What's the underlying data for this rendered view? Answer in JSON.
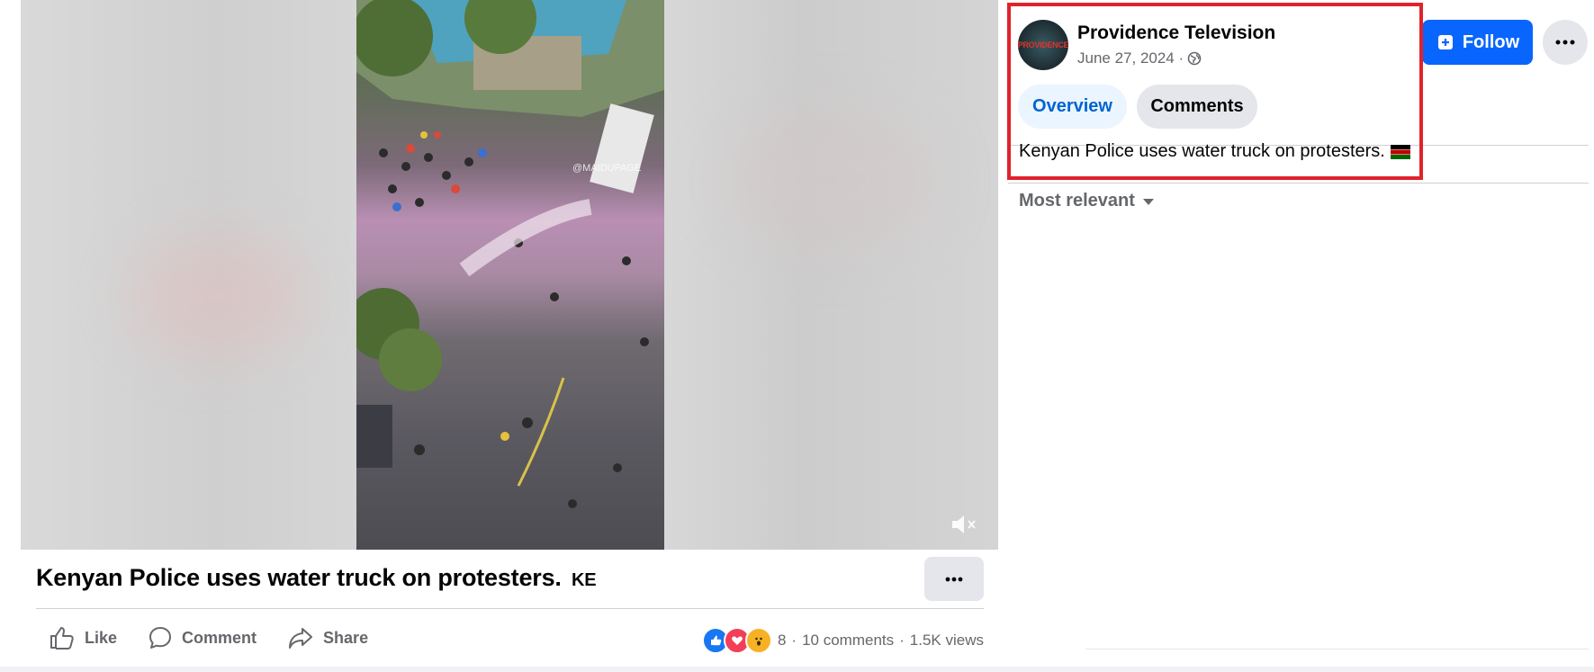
{
  "video": {
    "watermark": "@MAIDUPAGE"
  },
  "post": {
    "title": "Kenyan Police uses water truck on protesters.",
    "title_flag_code": "KE"
  },
  "actions": {
    "like": "Like",
    "comment": "Comment",
    "share": "Share"
  },
  "stats": {
    "reactions_count": "8",
    "separator": "·",
    "comments": "10 comments",
    "views": "1.5K views"
  },
  "page": {
    "name": "Providence Television",
    "date": "June 27, 2024 ·",
    "follow_label": "Follow"
  },
  "tabs": [
    {
      "label": "Overview",
      "active": true
    },
    {
      "label": "Comments",
      "active": false
    }
  ],
  "caption": "Kenyan Police uses water truck on protesters.",
  "sort_label": "Most relevant",
  "colors": {
    "accent": "#0866ff",
    "highlight_border": "#e0222b",
    "tab_active_bg": "#ebf5ff",
    "tab_active_text": "#0064d1"
  }
}
